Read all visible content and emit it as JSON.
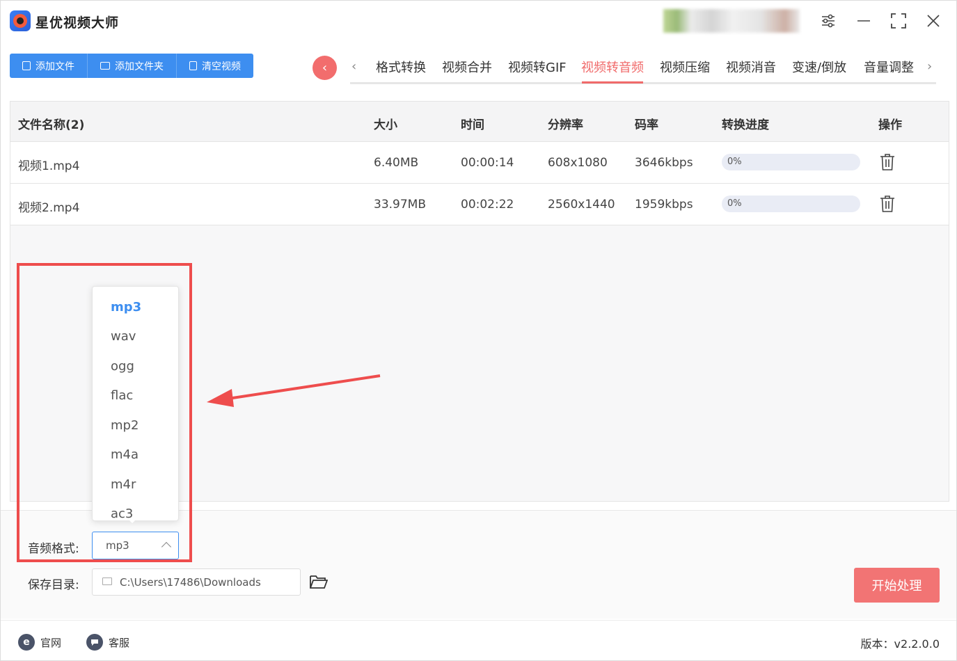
{
  "app": {
    "title": "星优视频大师"
  },
  "toolbar": {
    "add_file": "添加文件",
    "add_folder": "添加文件夹",
    "clear_video": "清空视频"
  },
  "tabs": [
    {
      "label": "格式转换"
    },
    {
      "label": "视频合并"
    },
    {
      "label": "视频转GIF"
    },
    {
      "label": "视频转音频",
      "active": true
    },
    {
      "label": "视频压缩"
    },
    {
      "label": "视频消音"
    },
    {
      "label": "变速/倒放"
    },
    {
      "label": "音量调整"
    }
  ],
  "table": {
    "headers": {
      "name": "文件名称(2)",
      "size": "大小",
      "time": "时间",
      "resolution": "分辨率",
      "bitrate": "码率",
      "progress": "转换进度",
      "action": "操作"
    },
    "rows": [
      {
        "name": "视频1.mp4",
        "size": "6.40MB",
        "time": "00:00:14",
        "resolution": "608x1080",
        "bitrate": "3646kbps",
        "progress": "0%",
        "progress_value": 0
      },
      {
        "name": "视频2.mp4",
        "size": "33.97MB",
        "time": "00:02:22",
        "resolution": "2560x1440",
        "bitrate": "1959kbps",
        "progress": "0%",
        "progress_value": 0
      }
    ]
  },
  "settings": {
    "audio_format_label": "音频格式:",
    "audio_format_value": "mp3",
    "audio_format_options": [
      "mp3",
      "wav",
      "ogg",
      "flac",
      "mp2",
      "m4a",
      "m4r",
      "ac3"
    ],
    "save_dir_label": "保存目录:",
    "save_dir_value": "C:\\Users\\17486\\Downloads",
    "start_button": "开始处理"
  },
  "footer": {
    "website": "官网",
    "support": "客服",
    "version": "版本：v2.2.0.0"
  },
  "colors": {
    "primary_blue": "#3d8ef0",
    "accent_red": "#f06a6a",
    "annotation_red": "#ee4d4d"
  },
  "icons": {
    "logo": "app-logo-icon",
    "settings": "sliders-icon",
    "minimize": "minimize-icon",
    "maximize": "maximize-icon",
    "close": "close-icon",
    "delete": "trash-icon",
    "folder": "folder-icon",
    "website": "ie-icon",
    "support": "chat-icon"
  }
}
